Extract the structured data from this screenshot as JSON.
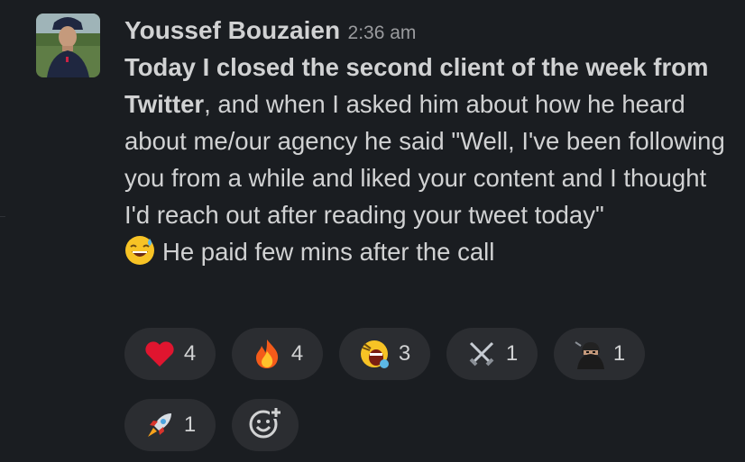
{
  "message": {
    "author": "Youssef Bouzaien",
    "timestamp": "2:36 am",
    "bold_text": "Today I closed the second client of the week from Twitter",
    "text_part1": ", and when I asked him about how he heard about me/our agency he said \"Well, I've been following you from a while and liked your content and I thought I'd reach out after reading your tweet today\"",
    "text_part2": "He paid few mins after the call",
    "inline_emoji": "sweat-smile-emoji"
  },
  "reactions": [
    {
      "emoji": "red-heart-emoji",
      "count": "4"
    },
    {
      "emoji": "fire-emoji",
      "count": "4"
    },
    {
      "emoji": "shouting-face-emoji",
      "count": "3"
    },
    {
      "emoji": "crossed-swords-emoji",
      "count": "1"
    },
    {
      "emoji": "ninja-emoji",
      "count": "1"
    },
    {
      "emoji": "rocket-emoji",
      "count": "1"
    }
  ],
  "add_reaction_icon": "add-reaction-icon",
  "colors": {
    "background": "#1a1d21",
    "pill": "#2b2d31",
    "text": "#d1d2d3",
    "muted": "#9a9b9e"
  }
}
